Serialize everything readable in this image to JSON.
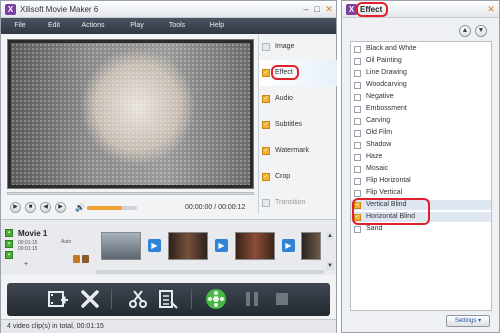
{
  "main_window": {
    "title": "Xilisoft Movie Maker 6",
    "controls": [
      "–",
      "□",
      "✕"
    ]
  },
  "menu": [
    "File",
    "Edit",
    "Actions",
    "Play",
    "Tools",
    "Help"
  ],
  "player": {
    "timecode": "00:00:00 / 00:00:12",
    "volume_level": 0.7
  },
  "tabs": [
    {
      "label": "Image",
      "checked": false
    },
    {
      "label": "Effect",
      "checked": true
    },
    {
      "label": "Audio",
      "checked": true
    },
    {
      "label": "Subtitles",
      "checked": true
    },
    {
      "label": "Watermark",
      "checked": true
    },
    {
      "label": "Crop",
      "checked": true
    },
    {
      "label": "Transition",
      "checked": false
    }
  ],
  "timeline": {
    "clip_name": "Movie 1",
    "clip_duration": "00:01:15",
    "clip_mode": "Auto",
    "clip_extra": "00:01:15",
    "add_label": "+"
  },
  "status": {
    "text": "4 video clip(s) in total, 00:01:15"
  },
  "effect_panel": {
    "title": "Effect",
    "settings_label": "Settings",
    "effects": [
      {
        "name": "Black and White",
        "checked": false
      },
      {
        "name": "Oil Painting",
        "checked": false
      },
      {
        "name": "Line Drawing",
        "checked": false
      },
      {
        "name": "Woodcarving",
        "checked": false
      },
      {
        "name": "Negative",
        "checked": false
      },
      {
        "name": "Embossment",
        "checked": false
      },
      {
        "name": "Carving",
        "checked": false
      },
      {
        "name": "Old Film",
        "checked": false
      },
      {
        "name": "Shadow",
        "checked": false
      },
      {
        "name": "Haze",
        "checked": false
      },
      {
        "name": "Mosaic",
        "checked": false
      },
      {
        "name": "Flip Horizontal",
        "checked": false
      },
      {
        "name": "Flip Vertical",
        "checked": false
      },
      {
        "name": "Vertical Blind",
        "checked": true
      },
      {
        "name": "Horizontal Blind",
        "checked": true
      },
      {
        "name": "Sand",
        "checked": false
      }
    ]
  },
  "colors": {
    "accent": "#f4b030",
    "highlight": "#e0212b",
    "menubar": "#2f3843",
    "transition": "#2f84d8"
  }
}
